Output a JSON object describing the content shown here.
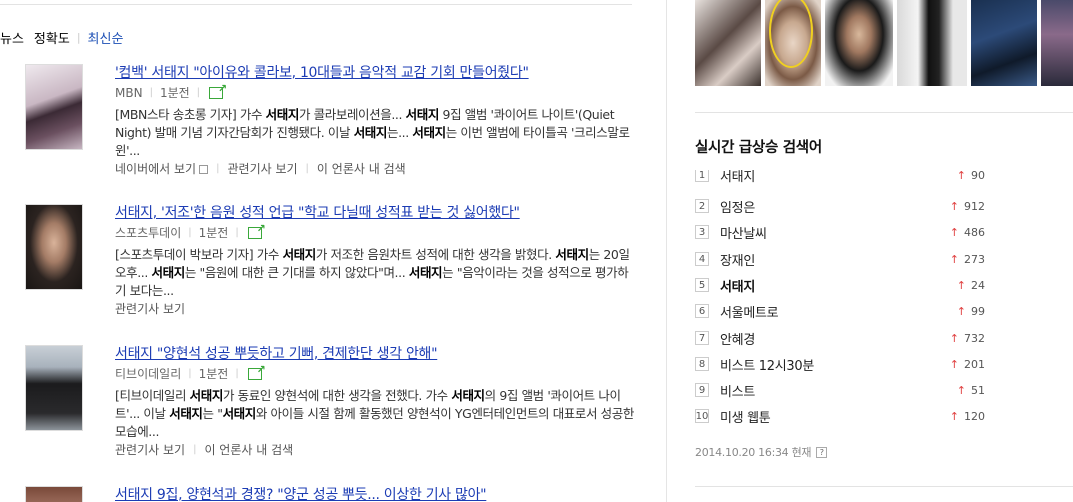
{
  "sort": {
    "label": "뉴스",
    "option_accuracy": "정확도",
    "option_latest": "최신순"
  },
  "news": [
    {
      "title": "'컴백' 서태지 \"아이유와 콜라보, 10대들과 음악적 교감 기회 만들어줬다\"",
      "source": "MBN",
      "time": "1분전",
      "desc_html": "[MBN스타 송초롱 기자] 가수 <b>서태지</b>가 콜라보레이션을... <b>서태지</b> 9집 앨범 '콰이어트 나이트'(Quiet Night) 발매 기념 기자간담회가 진행됐다. 이날 <b>서태지</b>는... <b>서태지</b>는 이번 앨범에 타이틀곡 '크리스말로윈'...",
      "links": [
        "네이버에서 보기",
        "관련기사 보기",
        "이 언론사 내 검색"
      ]
    },
    {
      "title": "서태지, '저조'한 음원 성적 언급 \"학교 다닐때 성적표 받는 것 싫어했다\"",
      "source": "스포츠투데이",
      "time": "1분전",
      "desc_html": "[스포츠투데이 박보라 기자] 가수 <b>서태지</b>가 저조한 음원차트 성적에 대한 생각을 밝혔다. <b>서태지</b>는 20일 오후... <b>서태지</b>는 \"음원에 대한 큰 기대를 하지 않았다\"며... <b>서태지</b>는 \"음악이라는 것을 성적으로 평가하기 보다는...",
      "links": [
        "관련기사 보기"
      ]
    },
    {
      "title": "서태지 \"양현석 성공 뿌듯하고 기뻐, 견제한단 생각 안해\"",
      "source": "티브이데일리",
      "time": "1분전",
      "desc_html": "[티브이데일리 <b>서태지</b>가 동료인 양현석에 대한 생각을 전했다. 가수 <b>서태지</b>의 9집 앨범 '콰이어트 나이트'... 이날 <b>서태지</b>는 \"<b>서태지</b>와 아이들 시절 함께 활동했던 양현석이 YG엔터테인먼트의 대표로서 성공한 모습에...",
      "links": [
        "관련기사 보기",
        "이 언론사 내 검색"
      ]
    },
    {
      "title": "서태지 9집, 양현석과 경쟁? \"양군 성공 뿌듯... 이상한 기사 많아\""
    }
  ],
  "realtime": {
    "title": "실시간 급상승 검색어",
    "items": [
      {
        "rank": "1",
        "keyword": "서태지",
        "change": "90"
      },
      {
        "rank": "2",
        "keyword": "임정은",
        "change": "912"
      },
      {
        "rank": "3",
        "keyword": "마산날씨",
        "change": "486"
      },
      {
        "rank": "4",
        "keyword": "장재인",
        "change": "273"
      },
      {
        "rank": "5",
        "keyword": "서태지",
        "change": "24"
      },
      {
        "rank": "6",
        "keyword": "서울메트로",
        "change": "99"
      },
      {
        "rank": "7",
        "keyword": "안혜경",
        "change": "732"
      },
      {
        "rank": "8",
        "keyword": "비스트 12시30분",
        "change": "201"
      },
      {
        "rank": "9",
        "keyword": "비스트",
        "change": "51"
      },
      {
        "rank": "10",
        "keyword": "미생 웹툰",
        "change": "120"
      }
    ],
    "timestamp": "2014.10.20 16:34 현재",
    "help": "?"
  },
  "colors": {
    "link_blue": "#1c3cb4",
    "up_arrow_red": "#e04040",
    "share_green": "#3aa83a"
  }
}
